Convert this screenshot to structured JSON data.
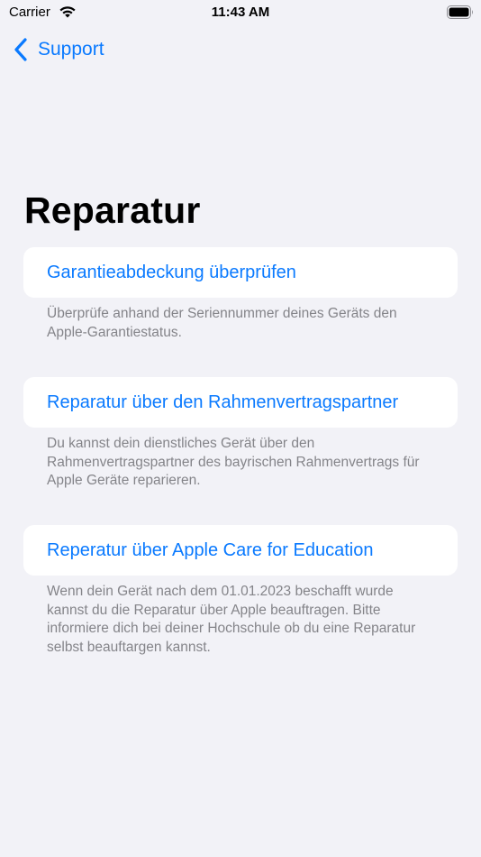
{
  "status_bar": {
    "carrier": "Carrier",
    "time": "11:43 AM"
  },
  "nav": {
    "back_label": "Support"
  },
  "title": "Reparatur",
  "sections": [
    {
      "link": "Garantieabdeckung überprüfen",
      "footer": "Überprüfe anhand der Seriennummer deines Geräts den Apple-Garantiestatus."
    },
    {
      "link": "Reparatur über den Rahmenvertragspartner",
      "footer": "Du kannst dein dienstliches Gerät über den Rahmenvertragspartner des bayrischen Rahmenvertrags für Apple Geräte reparieren."
    },
    {
      "link": "Reperatur über Apple Care for Education",
      "footer": "Wenn dein Gerät nach dem 01.01.2023 beschafft wurde kannst du die Reparatur über Apple beauftragen. Bitte informiere dich bei deiner Hochschule ob du eine Reparatur selbst beauftargen kannst."
    }
  ],
  "colors": {
    "accent": "#0a7aff",
    "background": "#f2f2f7",
    "card": "#ffffff",
    "footer_text": "#848489"
  },
  "icons": {
    "back": "chevron-left-icon",
    "wifi": "wifi-icon",
    "battery": "battery-icon"
  }
}
